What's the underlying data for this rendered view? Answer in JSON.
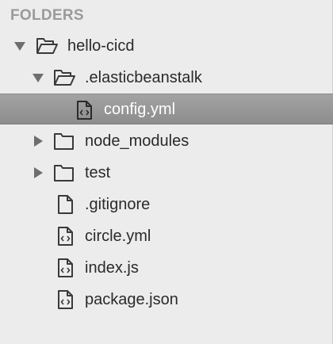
{
  "header": {
    "title": "FOLDERS"
  },
  "tree": [
    {
      "label": "hello-cicd",
      "type": "folder-open",
      "depth": 0,
      "expanded": true,
      "selected": false
    },
    {
      "label": ".elasticbeanstalk",
      "type": "folder-open",
      "depth": 1,
      "expanded": true,
      "selected": false
    },
    {
      "label": "config.yml",
      "type": "code-file",
      "depth": 2,
      "selected": true
    },
    {
      "label": "node_modules",
      "type": "folder",
      "depth": 1,
      "expanded": false,
      "selected": false
    },
    {
      "label": "test",
      "type": "folder",
      "depth": 1,
      "expanded": false,
      "selected": false
    },
    {
      "label": ".gitignore",
      "type": "file",
      "depth": 1,
      "selected": false
    },
    {
      "label": "circle.yml",
      "type": "code-file",
      "depth": 1,
      "selected": false
    },
    {
      "label": "index.js",
      "type": "code-file",
      "depth": 1,
      "selected": false
    },
    {
      "label": "package.json",
      "type": "code-file",
      "depth": 1,
      "selected": false
    }
  ],
  "colors": {
    "background": "#ececec",
    "header": "#9a9a9a",
    "text": "#2a2a2a",
    "selected_bg": "#999999",
    "selected_text": "#ffffff",
    "icon": "#3a3a3a",
    "arrow": "#6e6e6e"
  }
}
